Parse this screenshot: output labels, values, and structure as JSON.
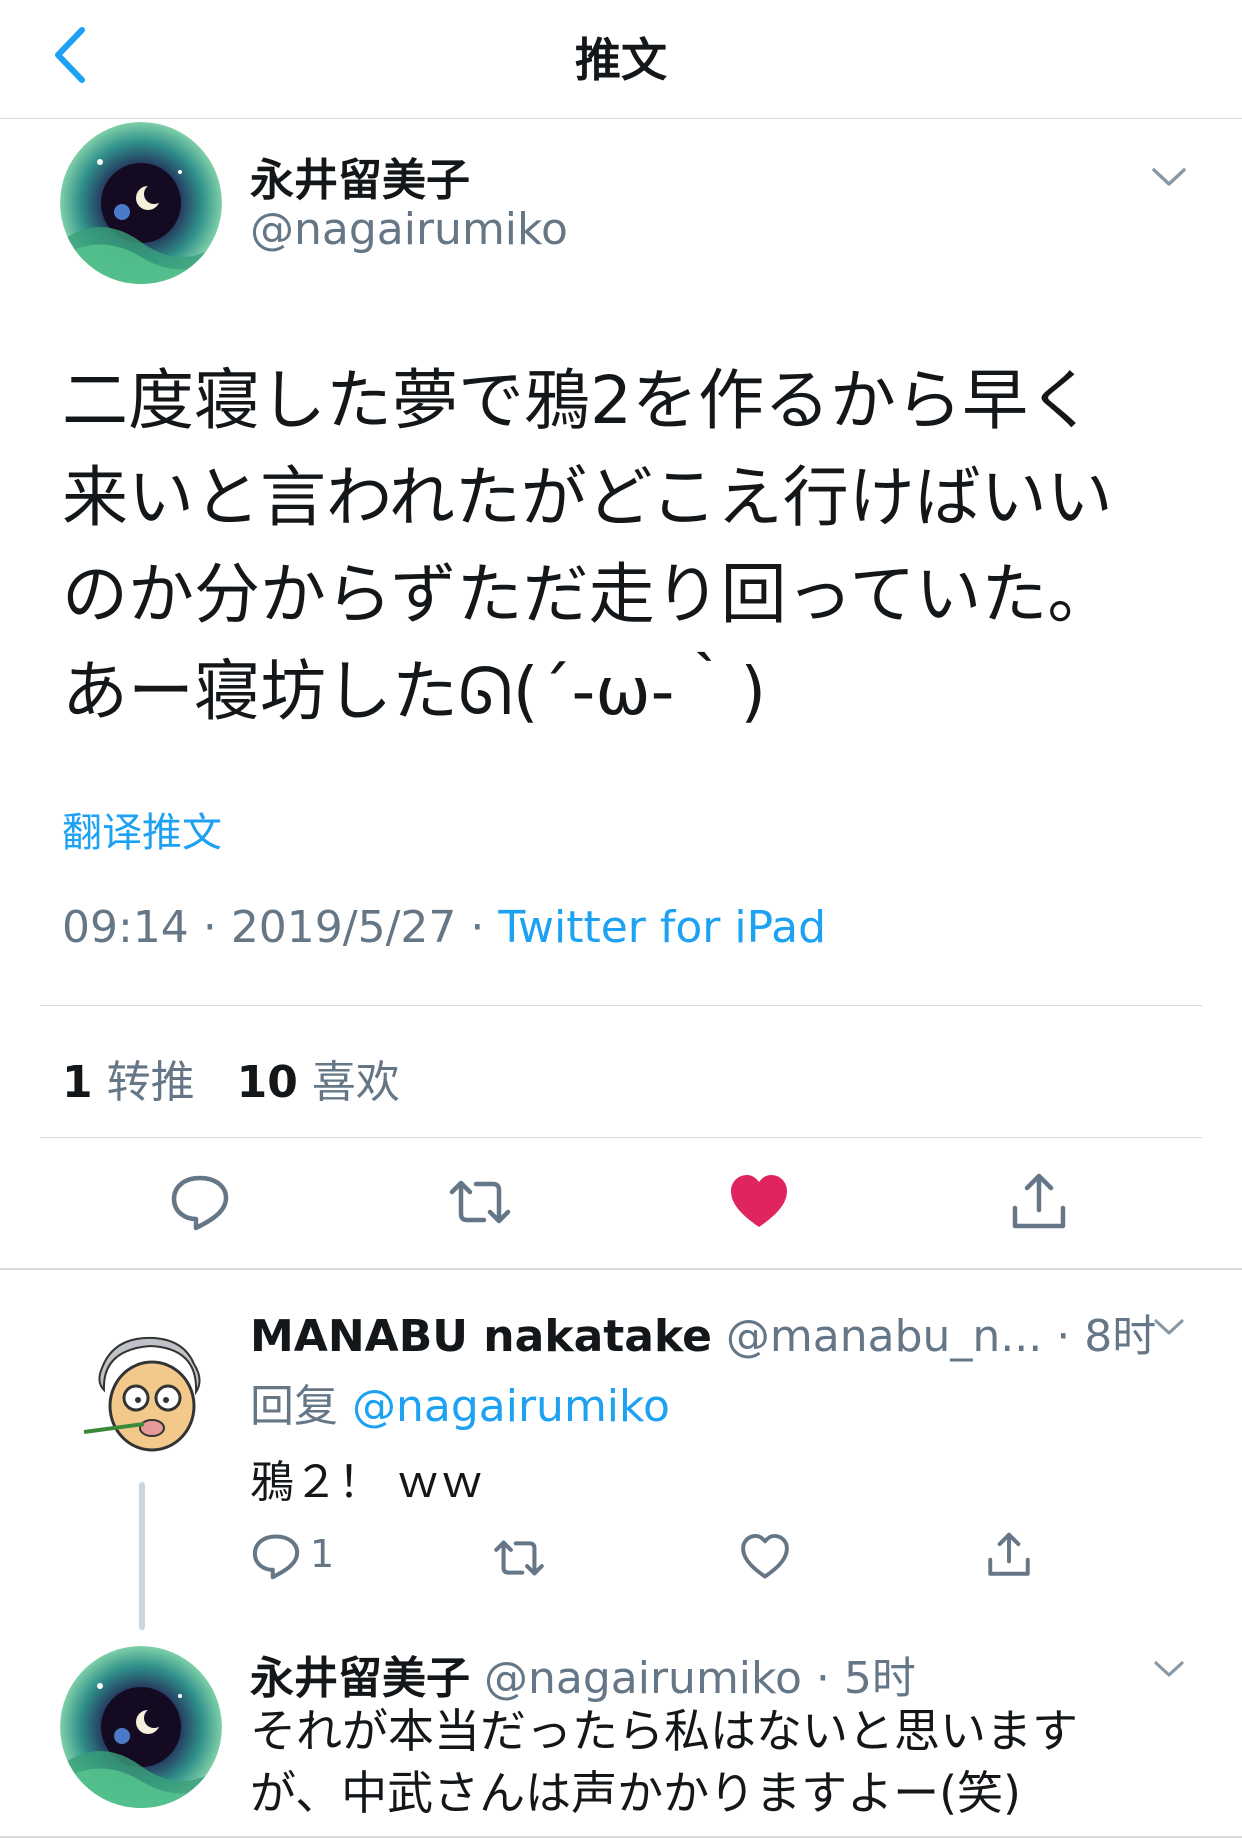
{
  "header": {
    "title": "推文",
    "back_icon": "chevron-left-icon"
  },
  "tweet": {
    "author_name": "永井留美子",
    "author_handle": "@nagairumiko",
    "text_lines": [
      "二度寝した夢で鴉2を作るから早く",
      "来いと言われたがどこえ行けばいい",
      "のか分からずただ走り回っていた。",
      "あー寝坊したᘏ(´-ω-｀)"
    ],
    "translate_label": "翻译推文",
    "time": "09:14",
    "date": "2019/5/27",
    "dot": "·",
    "source": "Twitter for iPad",
    "retweet_count": "1",
    "retweet_label": "转推",
    "like_count": "10",
    "like_label": "喜欢",
    "liked": true
  },
  "replies": [
    {
      "author_name": "MANABU nakatake",
      "author_handle": "@manabu_n...",
      "time": "· 8时",
      "reply_to_label": "回复",
      "reply_to_handle": "@nagairumiko",
      "text": "鴉２！ ｗｗ",
      "reply_count": "1"
    },
    {
      "author_name": "永井留美子",
      "author_handle": "@nagairumiko",
      "time": "· 5时",
      "text_lines": [
        "それが本当だったら私はないと思います",
        "が、中武さんは声かかりますよー(笑)"
      ]
    }
  ],
  "colors": {
    "accent": "#1da1f2",
    "like": "#e0245e",
    "secondary_text": "#657786",
    "divider": "#d6dbe0"
  }
}
